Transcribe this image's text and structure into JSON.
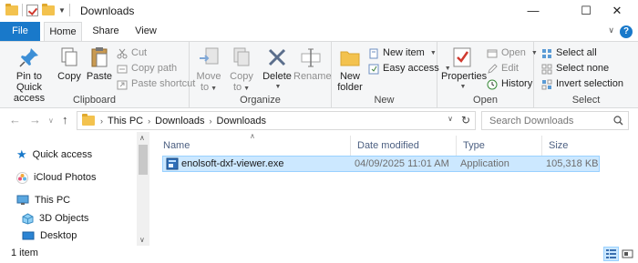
{
  "window": {
    "title": "Downloads",
    "minimize_glyph": "—",
    "maximize_glyph": "☐",
    "close_glyph": "✕"
  },
  "ribbon_tabs": {
    "file": "File",
    "home": "Home",
    "share": "Share",
    "view": "View",
    "help": "?"
  },
  "ribbon": {
    "clipboard": {
      "label": "Clipboard",
      "pin_line1": "Pin to Quick",
      "pin_line2": "access",
      "copy": "Copy",
      "paste": "Paste",
      "cut": "Cut",
      "copy_path": "Copy path",
      "paste_shortcut": "Paste shortcut"
    },
    "organize": {
      "label": "Organize",
      "move_to_line1": "Move",
      "move_to_line2": "to",
      "copy_to_line1": "Copy",
      "copy_to_line2": "to",
      "delete": "Delete",
      "rename": "Rename"
    },
    "new": {
      "label": "New",
      "new_folder_line1": "New",
      "new_folder_line2": "folder",
      "new_item": "New item",
      "easy_access": "Easy access"
    },
    "open": {
      "label": "Open",
      "properties": "Properties",
      "open": "Open",
      "edit": "Edit",
      "history": "History"
    },
    "select": {
      "label": "Select",
      "select_all": "Select all",
      "select_none": "Select none",
      "invert_selection": "Invert selection"
    }
  },
  "address": {
    "crumbs": [
      "This PC",
      "Downloads",
      "Downloads"
    ],
    "search_placeholder": "Search Downloads"
  },
  "nav_pane": {
    "items": [
      {
        "label": "Quick access",
        "icon": "star-icon"
      },
      {
        "label": "iCloud Photos",
        "icon": "icloud-photos-icon"
      },
      {
        "label": "This PC",
        "icon": "computer-icon"
      },
      {
        "label": "3D Objects",
        "icon": "3d-objects-icon"
      },
      {
        "label": "Desktop",
        "icon": "desktop-icon"
      }
    ]
  },
  "file_list": {
    "columns": [
      "Name",
      "Date modified",
      "Type",
      "Size"
    ],
    "rows": [
      {
        "name": "enolsoft-dxf-viewer.exe",
        "date_modified": "04/09/2025 11:01 AM",
        "type": "Application",
        "size": "105,318 KB"
      }
    ]
  },
  "status": {
    "item_count": "1 item"
  },
  "colors": {
    "accent": "#1979ca",
    "selection_bg": "#cce8ff",
    "selection_border": "#99d1ff",
    "header_text": "#4d6082"
  }
}
